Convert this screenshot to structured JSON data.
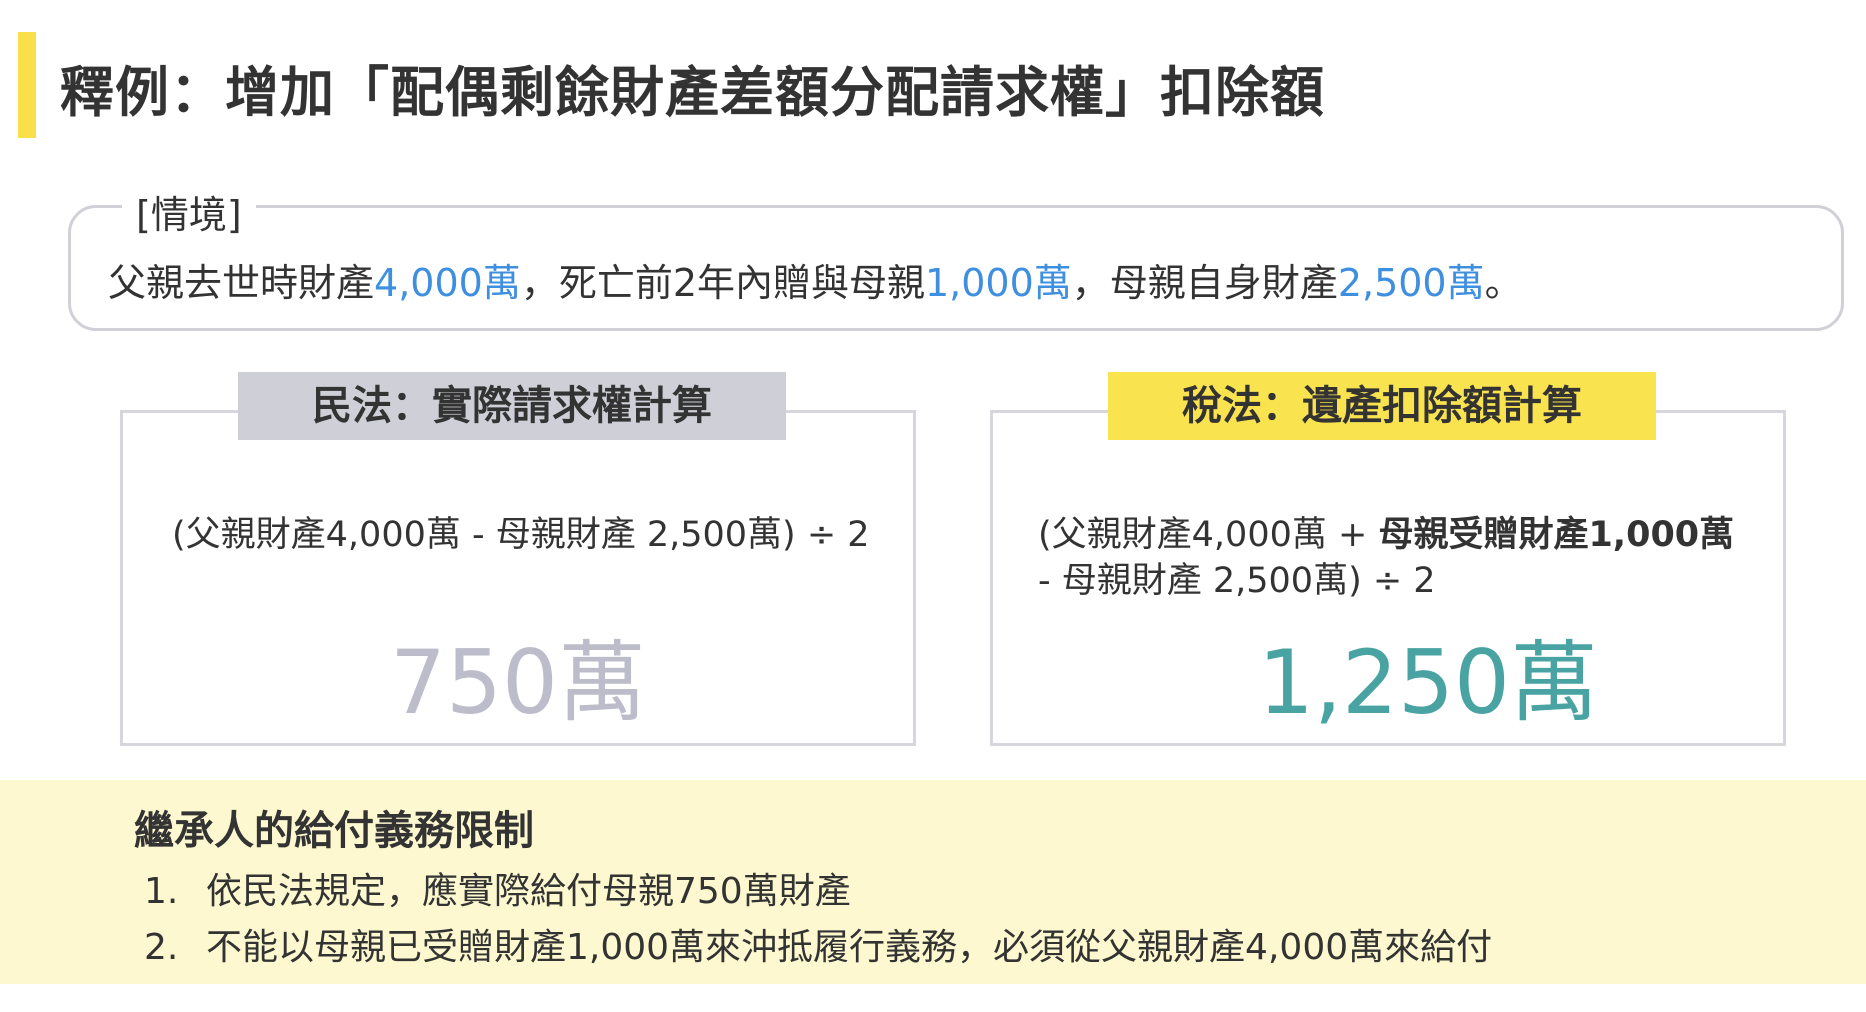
{
  "title": "釋例：增加「配偶剩餘財產差額分配請求權」扣除額",
  "scenario": {
    "label": "[情境]",
    "text_parts": [
      "父親去世時財產",
      "4,000萬",
      "，死亡前2年內贈與母親",
      "1,000萬",
      "，母親自身財產",
      "2,500萬",
      "。"
    ]
  },
  "civil_law": {
    "header": "民法：實際請求權計算",
    "formula": "(父親財產4,000萬 - 母親財產 2,500萬) ÷ 2",
    "result": "750萬"
  },
  "tax_law": {
    "header": "稅法：遺產扣除額計算",
    "formula_part1": "(父親財產4,000萬 + ",
    "formula_bold": "母親受贈財產1,000萬",
    "formula_part2": " - 母親財產 2,500萬) ÷ 2",
    "result": "1,250萬"
  },
  "duty": {
    "title": "繼承人的給付義務限制",
    "items": [
      {
        "num": "1.",
        "text": "依民法規定，應實際給付母親750萬財產"
      },
      {
        "num": "2.",
        "text": "不能以母親已受贈財產1,000萬來沖抵履行義務，必須從父親財產4,000萬來給付"
      }
    ]
  },
  "colors": {
    "accent_yellow": "#f9e04b",
    "highlight_blue": "#3f8fe0",
    "result_gray": "#bcbccb",
    "result_teal": "#4aa3a3",
    "header_gray": "#cfd0d7",
    "duty_background": "#fdf8cf"
  }
}
